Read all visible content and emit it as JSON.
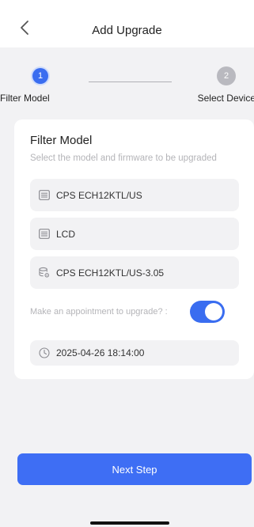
{
  "header": {
    "title": "Add Upgrade",
    "back_icon": "chevron-left-icon"
  },
  "stepper": {
    "steps": [
      {
        "number": "1",
        "label": "Filter Model",
        "active": true
      },
      {
        "number": "2",
        "label": "Select Device",
        "active": false
      }
    ]
  },
  "form": {
    "title": "Filter Model",
    "subtitle": "Select the model and firmware to be upgraded",
    "model": {
      "value": "CPS ECH12KTL/US",
      "icon": "list-icon"
    },
    "part": {
      "value": "LCD",
      "icon": "list-icon"
    },
    "firmware": {
      "value": "CPS ECH12KTL/US-3.05",
      "icon": "database-gear-icon"
    },
    "appointment": {
      "label": "Make an appointment to upgrade? :",
      "enabled": true
    },
    "datetime": {
      "value": "2025-04-26 18:14:00",
      "icon": "clock-icon"
    }
  },
  "footer": {
    "next_label": "Next Step"
  },
  "colors": {
    "accent": "#3e6ef4",
    "background": "#f2f2f4",
    "card": "#ffffff",
    "muted_text": "#b4b4b8"
  }
}
